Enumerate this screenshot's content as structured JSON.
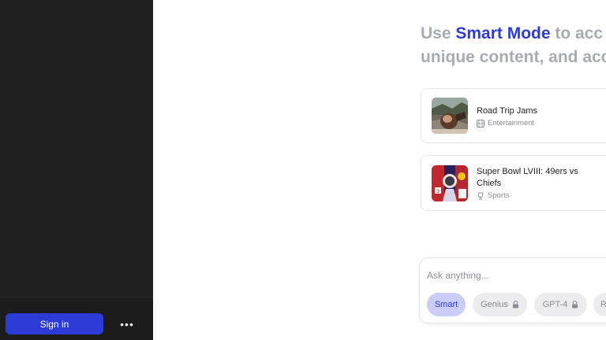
{
  "sidebar": {
    "signin_label": "Sign in",
    "more_label": "•••"
  },
  "headline": {
    "prefix": "Use ",
    "accent": "Smart Mode",
    "suffix": " to acc",
    "line2": "unique content, and acc"
  },
  "cards": [
    {
      "title": "Road Trip Jams",
      "category": "Entertainment",
      "category_icon": "film-icon"
    },
    {
      "title": "Super Bowl LVIII: 49ers vs Chiefs",
      "category": "Sports",
      "category_icon": "trophy-icon"
    }
  ],
  "ask": {
    "placeholder": "Ask anything..."
  },
  "modes": [
    {
      "label": "Smart",
      "locked": false,
      "selected": true
    },
    {
      "label": "Genius",
      "locked": true,
      "selected": false
    },
    {
      "label": "GPT-4",
      "locked": true,
      "selected": false
    },
    {
      "label": "R",
      "locked": false,
      "selected": false
    }
  ],
  "colors": {
    "accent": "#2d3bd6",
    "sidebar_bg": "#202020",
    "smart_chip_bg": "#c9cdf7"
  }
}
